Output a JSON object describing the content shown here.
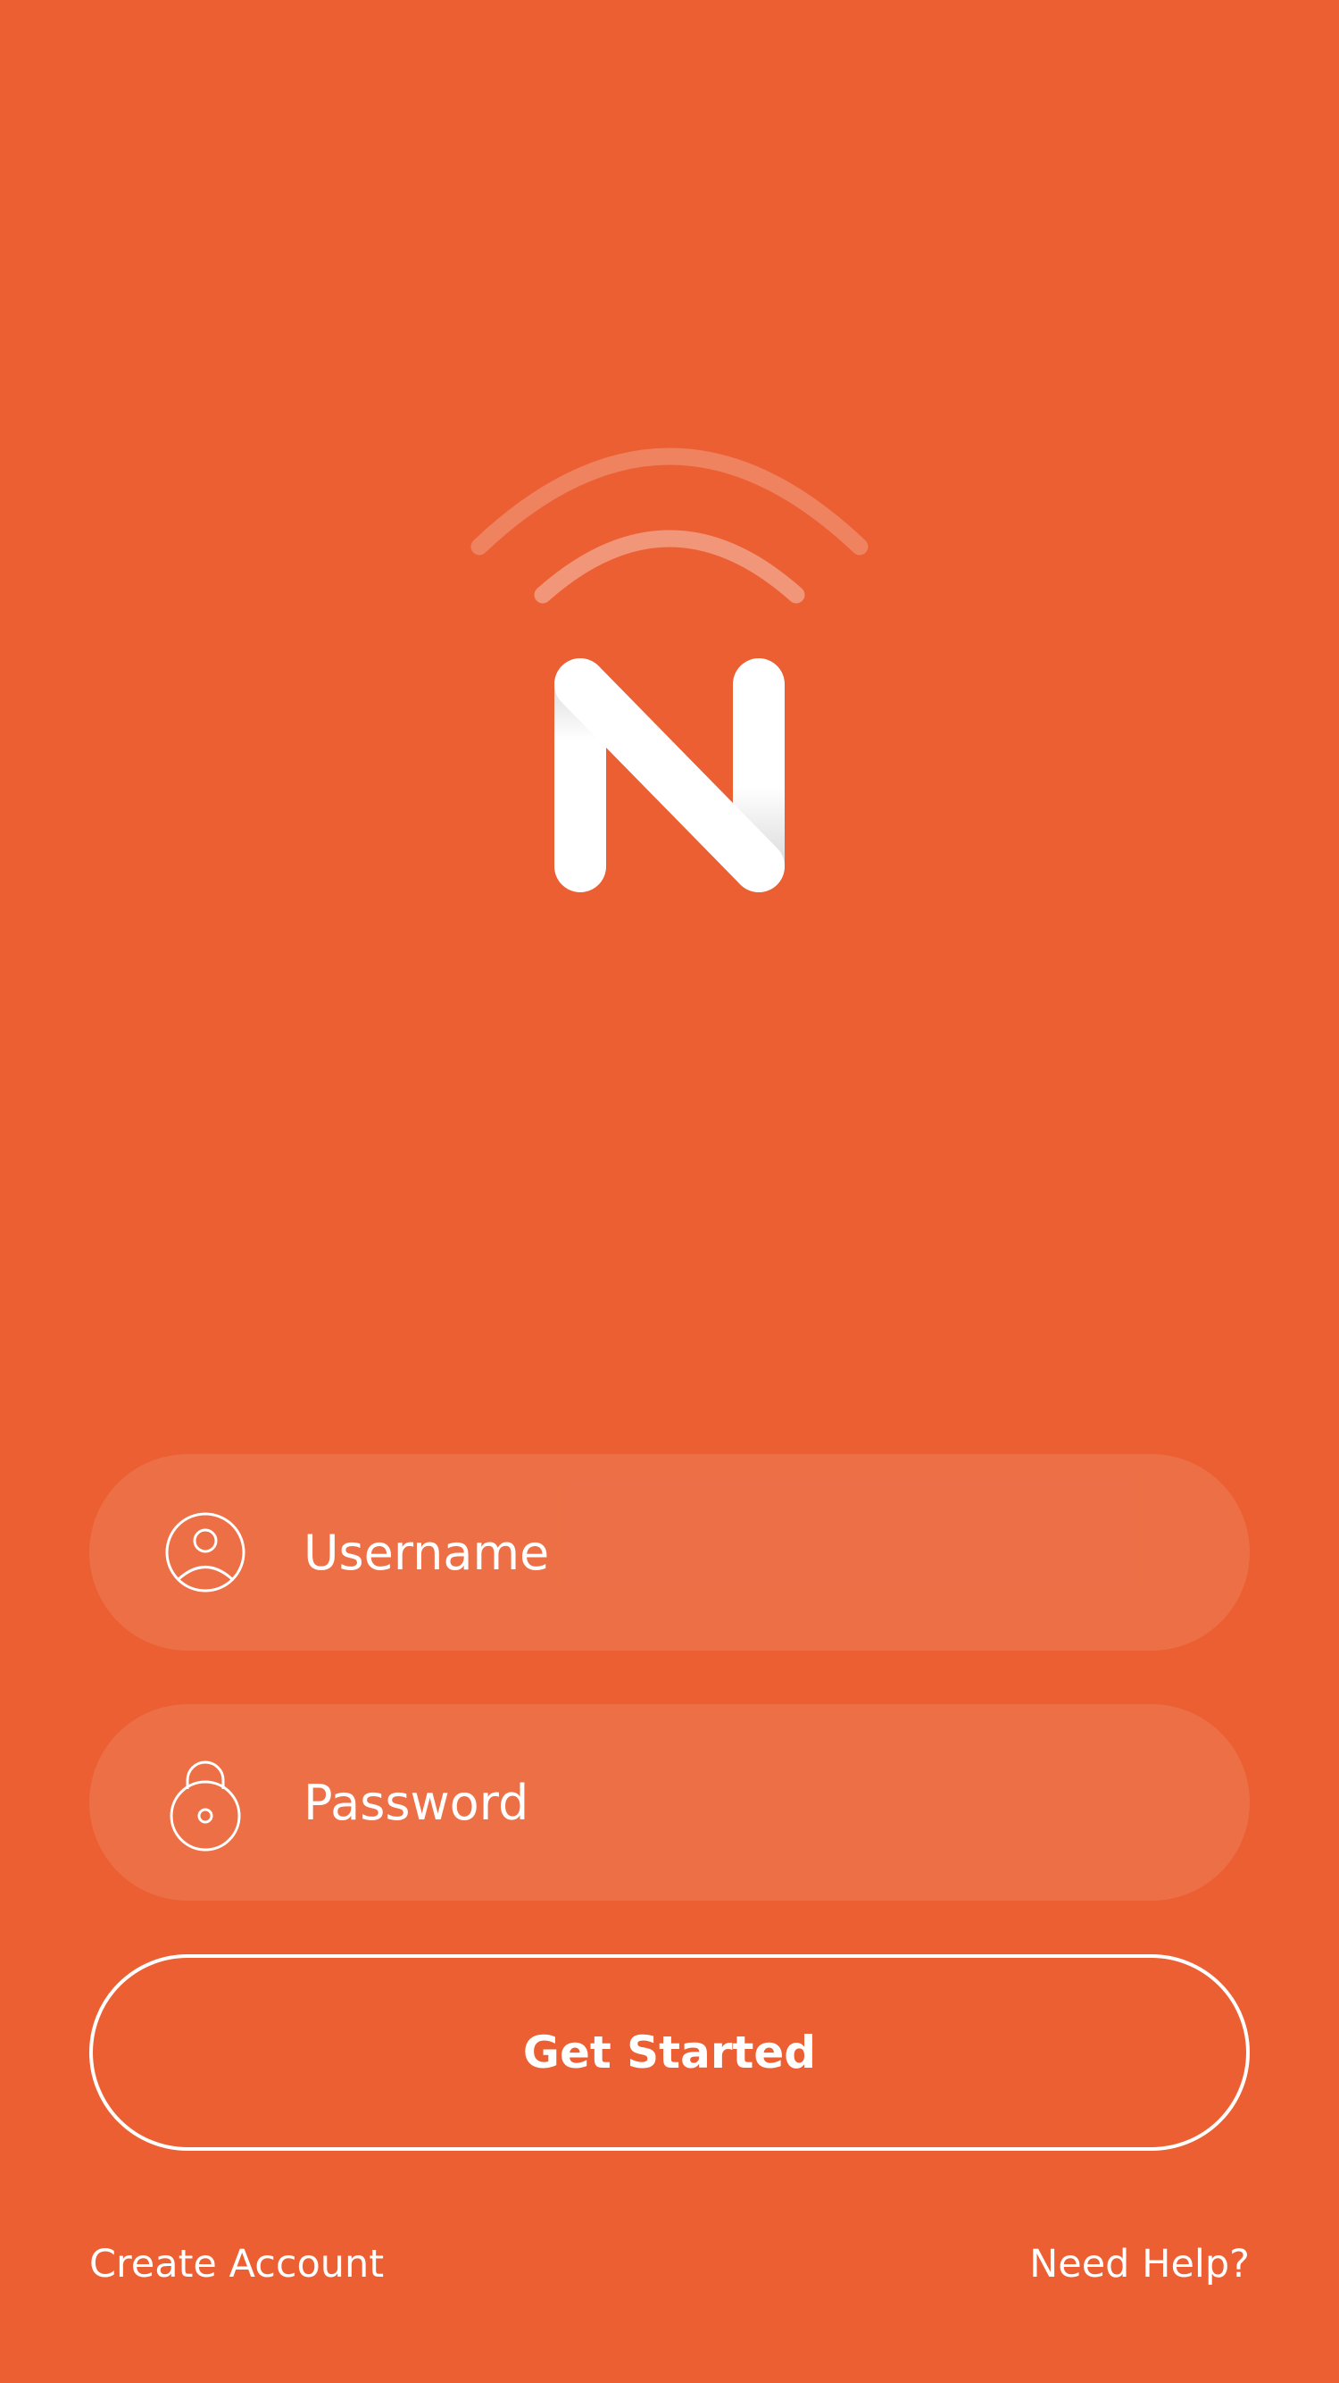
{
  "theme": {
    "background": "#EB5F32",
    "field_fill": "rgba(255,255,255,0.10)",
    "text": "#FFFFFF"
  },
  "logo": {
    "letter": "N",
    "icon": "wifi-signal-icon"
  },
  "form": {
    "username": {
      "placeholder": "Username",
      "value": "",
      "icon": "user-icon"
    },
    "password": {
      "placeholder": "Password",
      "value": "",
      "icon": "lock-icon"
    }
  },
  "cta": {
    "label": "Get Started"
  },
  "footer": {
    "create_account": "Create Account",
    "need_help": "Need Help?"
  }
}
